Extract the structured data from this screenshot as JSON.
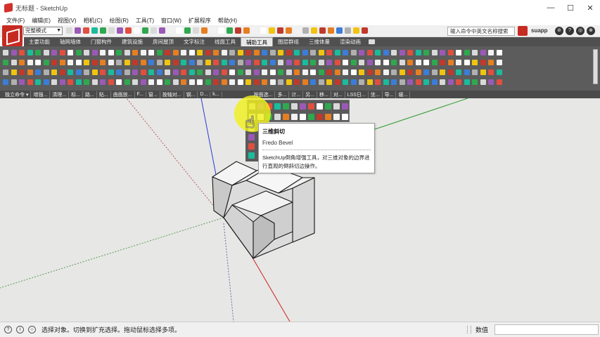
{
  "window": {
    "title": "无标题 - SketchUp",
    "minimize": "—",
    "maximize": "☐",
    "close": "✕"
  },
  "menu": [
    "文件(F)",
    "编辑(E)",
    "视图(V)",
    "相机(C)",
    "绘图(R)",
    "工具(T)",
    "窗口(W)",
    "扩展程序",
    "帮助(H)"
  ],
  "toolbar": {
    "mode_select": "完整模式",
    "search_placeholder": "输入命令中英文名称搜索",
    "brand": "suapp",
    "round_buttons": [
      "⊘",
      "?",
      "◎",
      "⊗"
    ]
  },
  "tabs": [
    {
      "label": "主要功能",
      "active": false
    },
    {
      "label": "轴网墙体",
      "active": false
    },
    {
      "label": "门窗构件",
      "active": false
    },
    {
      "label": "建筑设施",
      "active": false
    },
    {
      "label": "房间屋顶",
      "active": false
    },
    {
      "label": "文字标注",
      "active": false
    },
    {
      "label": "线面工具",
      "active": false
    },
    {
      "label": "辅助工具",
      "active": true
    },
    {
      "label": "图层群组",
      "active": false
    },
    {
      "label": "三维体量",
      "active": false
    },
    {
      "label": "渲染动画",
      "active": false
    }
  ],
  "group_labels": [
    "独立命令 ▾",
    "增强...",
    "清理...",
    "标...",
    "路...",
    "贴...",
    "曲面放...",
    "F...",
    "窗...",
    "按轴对...",
    "钢...",
    "D...",
    "k...",
    "",
    "",
    "",
    "",
    "",
    "",
    "按面选...",
    "多...",
    "计...",
    "另...",
    "移...",
    "对...",
    "LSS日...",
    "坐...",
    "导...",
    "缓..."
  ],
  "tooltip": {
    "title": "三维斜切",
    "subtitle": "Fredo Bevel",
    "description": "SketchUp倒角增强工具，对三维对象的边界进行直观的倒斜切边操作。"
  },
  "statusbar": {
    "message": "选择对象。切换到扩充选择。拖动鼠标选择多项。",
    "value_label": "数值",
    "value": ""
  },
  "colors": {
    "panel_bg": "#5c5c5c",
    "viewport_bg": "#e7e7e5",
    "highlight": "#f0f01e",
    "brand_red": "#c62b22",
    "axis_red": "#cc2222",
    "axis_green": "#2f9a2f",
    "axis_blue": "#2a3bd6"
  }
}
